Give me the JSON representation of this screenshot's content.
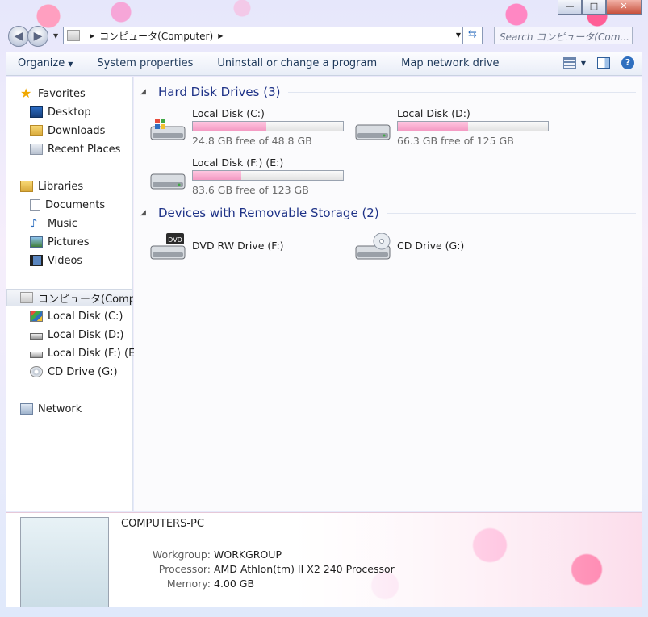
{
  "window": {
    "caption": {
      "minimize": "—",
      "maximize": "□",
      "close": "✕"
    }
  },
  "nav": {
    "address": "コンピュータ(Computer)",
    "search_placeholder": "Search コンピュータ(Com..."
  },
  "toolbar": {
    "organize": "Organize",
    "system_properties": "System properties",
    "uninstall": "Uninstall or change a program",
    "map_drive": "Map network drive"
  },
  "sidebar": {
    "favorites": "Favorites",
    "desktop": "Desktop",
    "downloads": "Downloads",
    "recent": "Recent Places",
    "libraries": "Libraries",
    "documents": "Documents",
    "music": "Music",
    "pictures": "Pictures",
    "videos": "Videos",
    "computer": "コンピュータ(Computer)",
    "disk_c": "Local Disk (C:)",
    "disk_d": "Local Disk (D:)",
    "disk_f": "Local Disk (F:) (E:)",
    "cd_g": "CD Drive (G:)",
    "network": "Network"
  },
  "content": {
    "hdd_group": "Hard Disk Drives (3)",
    "removable_group": "Devices with Removable Storage (2)",
    "drives": [
      {
        "name": "Local Disk (C:)",
        "free": "24.8 GB free of 48.8 GB",
        "used_fraction": 0.49
      },
      {
        "name": "Local Disk (D:)",
        "free": "66.3 GB free of 125 GB",
        "used_fraction": 0.47
      },
      {
        "name": "Local Disk (F:) (E:)",
        "free": "83.6 GB free of 123 GB",
        "used_fraction": 0.32
      }
    ],
    "removable": [
      {
        "name": "DVD RW Drive (F:)",
        "badge": "DVD"
      },
      {
        "name": "CD Drive (G:)"
      }
    ]
  },
  "details": {
    "title": "COMPUTERS-PC",
    "workgroup_label": "Workgroup:",
    "workgroup": "WORKGROUP",
    "processor_label": "Processor:",
    "processor": "AMD Athlon(tm) II X2 240 Processor",
    "memory_label": "Memory:",
    "memory": "4.00 GB"
  },
  "colors": {
    "accent_title": "#1e3287",
    "bar_fill": "#f49ac3",
    "toolbar_text": "#1e395b"
  }
}
